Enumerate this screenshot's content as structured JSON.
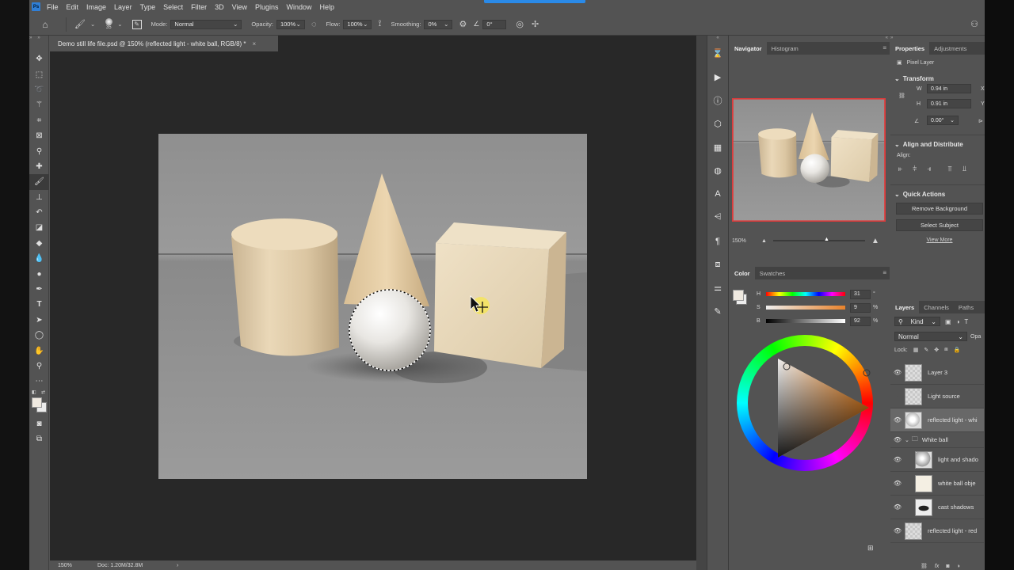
{
  "app": {
    "logo": "Ps"
  },
  "menu": [
    "File",
    "Edit",
    "Image",
    "Layer",
    "Type",
    "Select",
    "Filter",
    "3D",
    "View",
    "Plugins",
    "Window",
    "Help"
  ],
  "options": {
    "brush_size": "35",
    "mode_label": "Mode:",
    "mode_value": "Normal",
    "opacity_label": "Opacity:",
    "opacity_value": "100%",
    "flow_label": "Flow:",
    "flow_value": "100%",
    "smoothing_label": "Smoothing:",
    "smoothing_value": "0%",
    "angle_value": "0°"
  },
  "document": {
    "tab_title": "Demo still life file.psd @ 150% (reflected light - white ball, RGB/8) *",
    "zoom": "150%",
    "doc_info": "Doc: 1.20M/32.8M"
  },
  "navigator": {
    "tabs": [
      "Navigator",
      "Histogram"
    ],
    "zoom": "150%"
  },
  "color_panel": {
    "tabs": [
      "Color",
      "Swatches"
    ],
    "h_label": "H",
    "h_value": "31",
    "h_unit": "°",
    "s_label": "S",
    "s_value": "9",
    "s_unit": "%",
    "b_label": "B",
    "b_value": "92",
    "b_unit": "%"
  },
  "properties": {
    "tabs": [
      "Properties",
      "Adjustments"
    ],
    "layer_type": "Pixel Layer",
    "transform_title": "Transform",
    "w_label": "W",
    "w_value": "0.94 in",
    "h_label": "H",
    "h_value": "0.91 in",
    "x_label": "X",
    "x_value": "2.",
    "y_label": "Y",
    "y_value": "1.",
    "angle_value": "0.00°",
    "align_title": "Align and Distribute",
    "align_label": "Align:",
    "quick_actions_title": "Quick Actions",
    "remove_bg": "Remove Background",
    "select_subject": "Select Subject",
    "view_more": "View More"
  },
  "layers_panel": {
    "tabs": [
      "Layers",
      "Channels",
      "Paths"
    ],
    "kind_label": "Kind",
    "blend_mode": "Normal",
    "opacity_short": "Opa",
    "lock_label": "Lock:",
    "layers": [
      {
        "name": "Layer 3",
        "visible": true
      },
      {
        "name": "Light source",
        "visible": false
      },
      {
        "name": "reflected light - whi",
        "visible": true
      },
      {
        "name": "White ball",
        "visible": true
      },
      {
        "name": "light and shado",
        "visible": true
      },
      {
        "name": "white ball obje",
        "visible": true
      },
      {
        "name": "cast shadows",
        "visible": true
      },
      {
        "name": "reflected light - red",
        "visible": true
      }
    ]
  },
  "colors": {
    "ui_bg": "#535353",
    "canvas_bg": "#909090",
    "object_cream": "#e6d3b2",
    "selection": "#ffffff"
  }
}
